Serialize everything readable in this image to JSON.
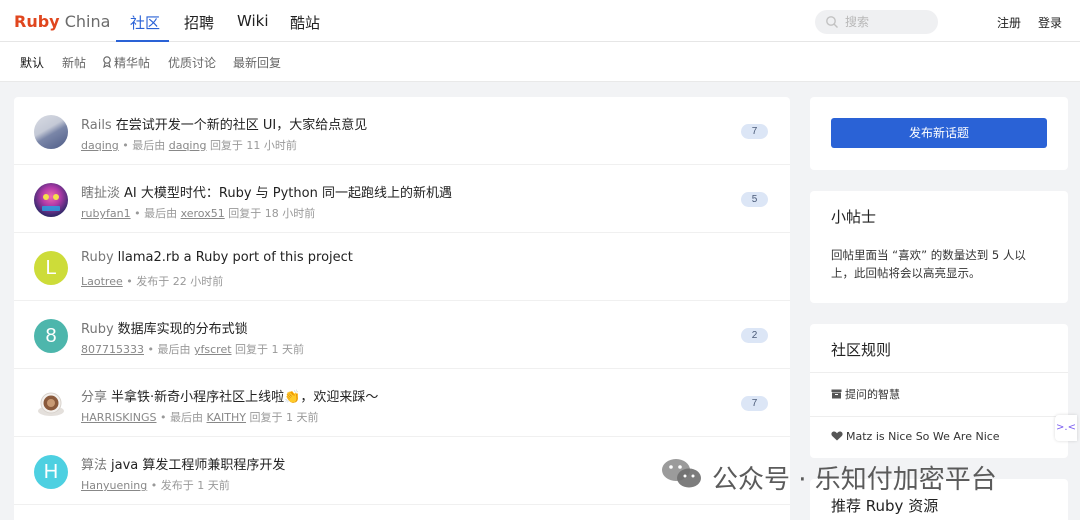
{
  "header": {
    "logo_ruby": "Ruby",
    "logo_china": "China",
    "nav": [
      {
        "label": "社区"
      },
      {
        "label": "招聘"
      },
      {
        "label": "Wiki"
      },
      {
        "label": "酷站"
      }
    ],
    "search_placeholder": "搜索",
    "register": "注册",
    "login": "登录",
    "accent_color": "#2a62d6",
    "brand_color": "#e0461e"
  },
  "subnav": [
    {
      "label": "默认"
    },
    {
      "label": "新帖"
    },
    {
      "label": "精华帖",
      "icon": "medal-icon"
    },
    {
      "label": "优质讨论"
    },
    {
      "label": "最新回复"
    }
  ],
  "topics": [
    {
      "node": "Rails",
      "title": "在尝试开发一个新的社区 UI，大家给点意见",
      "author": "daqing",
      "sep": "•",
      "meta_mid": "最后由",
      "last_user": "daqing",
      "meta_end": "回复于 11 小时前",
      "count": "7"
    },
    {
      "node": "瞎扯淡",
      "title": "AI 大模型时代：Ruby 与 Python 同一起跑线上的新机遇",
      "author": "rubyfan1",
      "sep": "•",
      "meta_mid": "最后由",
      "last_user": "xerox51",
      "meta_end": "回复于 18 小时前",
      "count": "5"
    },
    {
      "node": "Ruby",
      "title": "llama2.rb a Ruby port of this project",
      "author": "Laotree",
      "sep": "•",
      "meta_end": "发布于 22 小时前",
      "avatar_letter": "L"
    },
    {
      "node": "Ruby",
      "title": "数据库实现的分布式锁",
      "author": "807715333",
      "sep": "•",
      "meta_mid": "最后由",
      "last_user": "yfscret",
      "meta_end": "回复于 1 天前",
      "count": "2",
      "avatar_letter": "8"
    },
    {
      "node": "分享",
      "title": "半拿铁·新奇小程序社区上线啦👏，欢迎来踩～",
      "author": "HARRISKINGS",
      "sep": "•",
      "meta_mid": "最后由",
      "last_user": "KAITHY",
      "meta_end": "回复于 1 天前",
      "count": "7"
    },
    {
      "node": "算法",
      "title": "java 算发工程师兼职程序开发",
      "author": "Hanyuening",
      "sep": "•",
      "meta_end": "发布于 1 天前",
      "avatar_letter": "H"
    }
  ],
  "sidebar": {
    "new_topic": "发布新话题",
    "tips_title": "小帖士",
    "tips_text": "回帖里面当 “喜欢” 的数量达到 5 人以上，此回帖将会以高亮显示。",
    "rules_title": "社区规则",
    "rules": [
      {
        "label": "提问的智慧",
        "icon": "archive-icon"
      },
      {
        "label": "Matz is Nice So We Are Nice",
        "icon": "heart-icon"
      }
    ],
    "resources_title": "推荐 Ruby 资源"
  },
  "side_tab_label": ">.<",
  "watermark": "公众号 · 乐知付加密平台"
}
